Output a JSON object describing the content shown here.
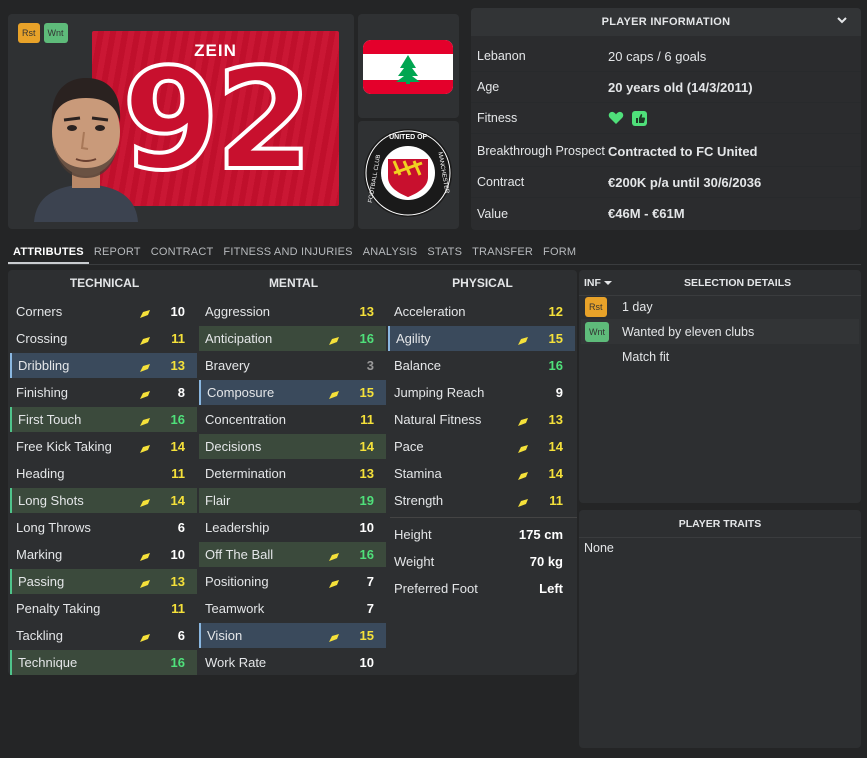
{
  "header": {
    "badges": [
      "Rst",
      "Wnt"
    ],
    "shirt_name": "ZEIN",
    "shirt_number": "92"
  },
  "player_info": {
    "title": "PLAYER INFORMATION",
    "rows": [
      {
        "label": "Lebanon",
        "value": "20 caps / 6 goals",
        "bold": false
      },
      {
        "label": "Age",
        "value": "20 years old (14/3/2011)",
        "bold": true
      },
      {
        "label": "Fitness",
        "value": "",
        "bold": false
      },
      {
        "label": "Breakthrough Prospect",
        "value": "Contracted to FC United",
        "bold": true
      },
      {
        "label": "Contract",
        "value": "€200K p/a until 30/6/2036",
        "bold": true
      },
      {
        "label": "Value",
        "value": "€46M - €61M",
        "bold": true
      }
    ]
  },
  "tabs": [
    "ATTRIBUTES",
    "REPORT",
    "CONTRACT",
    "FITNESS AND INJURIES",
    "ANALYSIS",
    "STATS",
    "TRANSFER",
    "FORM"
  ],
  "attributes": {
    "technical": {
      "title": "TECHNICAL",
      "items": [
        {
          "name": "Corners",
          "value": "10",
          "arrow": true,
          "color": "#ffffff",
          "hl": ""
        },
        {
          "name": "Crossing",
          "value": "11",
          "arrow": true,
          "color": "#f5e13a",
          "hl": ""
        },
        {
          "name": "Dribbling",
          "value": "13",
          "arrow": true,
          "color": "#f5e13a",
          "hl": "hb"
        },
        {
          "name": "Finishing",
          "value": "8",
          "arrow": true,
          "color": "#ffffff",
          "hl": ""
        },
        {
          "name": "First Touch",
          "value": "16",
          "arrow": true,
          "color": "#4fe07a",
          "hl": "hlg"
        },
        {
          "name": "Free Kick Taking",
          "value": "14",
          "arrow": true,
          "color": "#f5e13a",
          "hl": ""
        },
        {
          "name": "Heading",
          "value": "11",
          "arrow": false,
          "color": "#f5e13a",
          "hl": ""
        },
        {
          "name": "Long Shots",
          "value": "14",
          "arrow": true,
          "color": "#f5e13a",
          "hl": "hlg"
        },
        {
          "name": "Long Throws",
          "value": "6",
          "arrow": false,
          "color": "#ffffff",
          "hl": ""
        },
        {
          "name": "Marking",
          "value": "10",
          "arrow": true,
          "color": "#ffffff",
          "hl": ""
        },
        {
          "name": "Passing",
          "value": "13",
          "arrow": true,
          "color": "#f5e13a",
          "hl": "hlg"
        },
        {
          "name": "Penalty Taking",
          "value": "11",
          "arrow": false,
          "color": "#f5e13a",
          "hl": ""
        },
        {
          "name": "Tackling",
          "value": "6",
          "arrow": true,
          "color": "#ffffff",
          "hl": ""
        },
        {
          "name": "Technique",
          "value": "16",
          "arrow": false,
          "color": "#4fe07a",
          "hl": "hlg"
        }
      ]
    },
    "mental": {
      "title": "MENTAL",
      "items": [
        {
          "name": "Aggression",
          "value": "13",
          "arrow": false,
          "color": "#f5e13a",
          "hl": ""
        },
        {
          "name": "Anticipation",
          "value": "16",
          "arrow": true,
          "color": "#4fe07a",
          "hl": "hl"
        },
        {
          "name": "Bravery",
          "value": "3",
          "arrow": false,
          "color": "#9a9a9a",
          "hl": ""
        },
        {
          "name": "Composure",
          "value": "15",
          "arrow": true,
          "color": "#f5e13a",
          "hl": "hb"
        },
        {
          "name": "Concentration",
          "value": "11",
          "arrow": false,
          "color": "#f5e13a",
          "hl": ""
        },
        {
          "name": "Decisions",
          "value": "14",
          "arrow": false,
          "color": "#f5e13a",
          "hl": "hl"
        },
        {
          "name": "Determination",
          "value": "13",
          "arrow": false,
          "color": "#f5e13a",
          "hl": ""
        },
        {
          "name": "Flair",
          "value": "19",
          "arrow": false,
          "color": "#4fe07a",
          "hl": "hl"
        },
        {
          "name": "Leadership",
          "value": "10",
          "arrow": false,
          "color": "#ffffff",
          "hl": ""
        },
        {
          "name": "Off The Ball",
          "value": "16",
          "arrow": true,
          "color": "#4fe07a",
          "hl": "hl"
        },
        {
          "name": "Positioning",
          "value": "7",
          "arrow": true,
          "color": "#ffffff",
          "hl": ""
        },
        {
          "name": "Teamwork",
          "value": "7",
          "arrow": false,
          "color": "#ffffff",
          "hl": ""
        },
        {
          "name": "Vision",
          "value": "15",
          "arrow": true,
          "color": "#f5e13a",
          "hl": "hb"
        },
        {
          "name": "Work Rate",
          "value": "10",
          "arrow": false,
          "color": "#ffffff",
          "hl": ""
        }
      ]
    },
    "physical": {
      "title": "PHYSICAL",
      "items": [
        {
          "name": "Acceleration",
          "value": "12",
          "arrow": false,
          "color": "#f5e13a",
          "hl": ""
        },
        {
          "name": "Agility",
          "value": "15",
          "arrow": true,
          "color": "#f5e13a",
          "hl": "hb"
        },
        {
          "name": "Balance",
          "value": "16",
          "arrow": false,
          "color": "#4fe07a",
          "hl": ""
        },
        {
          "name": "Jumping Reach",
          "value": "9",
          "arrow": false,
          "color": "#ffffff",
          "hl": ""
        },
        {
          "name": "Natural Fitness",
          "value": "13",
          "arrow": true,
          "color": "#f5e13a",
          "hl": ""
        },
        {
          "name": "Pace",
          "value": "14",
          "arrow": true,
          "color": "#f5e13a",
          "hl": ""
        },
        {
          "name": "Stamina",
          "value": "14",
          "arrow": true,
          "color": "#f5e13a",
          "hl": ""
        },
        {
          "name": "Strength",
          "value": "11",
          "arrow": true,
          "color": "#f5e13a",
          "hl": ""
        }
      ],
      "extras": [
        {
          "name": "Height",
          "value": "175 cm"
        },
        {
          "name": "Weight",
          "value": "70 kg"
        },
        {
          "name": "Preferred Foot",
          "value": "Left"
        }
      ]
    }
  },
  "selection": {
    "inf_label": "INF",
    "title": "SELECTION DETAILS",
    "rows": [
      {
        "badge": "Rst",
        "text": "1 day"
      },
      {
        "badge": "Wnt",
        "text": "Wanted by eleven clubs"
      },
      {
        "badge": "",
        "text": "Match fit"
      }
    ]
  },
  "traits": {
    "title": "PLAYER TRAITS",
    "value": "None"
  },
  "colors": {
    "flag_red": "#e4002b",
    "crest_red": "#c8102e",
    "fitness_green": "#4fe07a"
  },
  "crest_text": "FOOTBALL CLUB UNITED OF MANCHESTER"
}
